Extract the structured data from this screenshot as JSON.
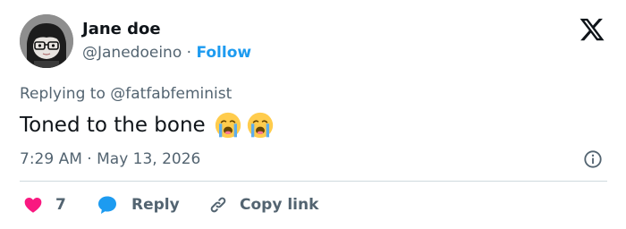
{
  "author": {
    "display_name": "Jane doe",
    "handle": "@Janedoeino",
    "separator": " · ",
    "follow_label": "Follow"
  },
  "reply_context": {
    "prefix": "Replying to ",
    "target": "@fatfabfeminist"
  },
  "tweet": {
    "text": "Toned to the bone",
    "emojis": [
      "loudly-crying-face",
      "loudly-crying-face"
    ],
    "time": "7:29 AM",
    "separator": " · ",
    "date": "May 13, 2026"
  },
  "actions": {
    "like_count": "7",
    "reply_label": "Reply",
    "copy_link_label": "Copy link"
  },
  "icons": {
    "brand": "x-logo-icon",
    "info": "info-icon",
    "like": "heart-icon",
    "reply": "speech-bubble-icon",
    "copy": "link-icon"
  },
  "colors": {
    "accent": "#1d9bf0",
    "like": "#f91880",
    "text_primary": "#0f1419",
    "text_secondary": "#536471",
    "divider": "#cfd9de"
  }
}
